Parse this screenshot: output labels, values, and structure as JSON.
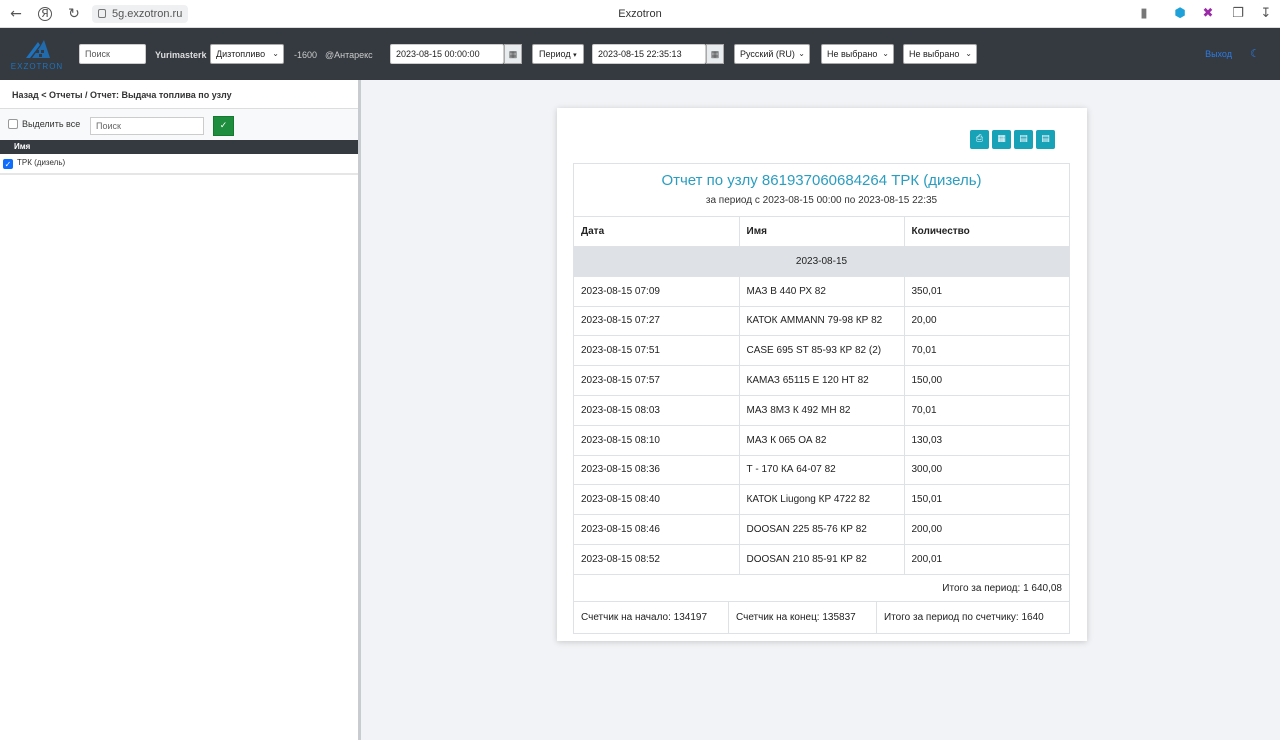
{
  "browser": {
    "url": "5g.exzotron.ru",
    "tab_title": "Exzotron"
  },
  "header": {
    "logo_text": "EXZOTRON",
    "search_placeholder": "Поиск",
    "username": "Yurimasterk",
    "fuel_select": "Дизтопливо",
    "balance": "-1600",
    "org": "@Антарекс",
    "date_from": "2023-08-15 00:00:00",
    "period_label": "Период",
    "date_to": "2023-08-15 22:35:13",
    "language": "Русский (RU)",
    "filter1": "Не выбрано",
    "filter2": "Не выбрано",
    "exit_label": "Выход"
  },
  "sidebar": {
    "breadcrumb": "Назад < Отчеты / Отчет: Выдача топлива по узлу",
    "select_all_label": "Выделить все",
    "search_placeholder": "Поиск",
    "column_header": "Имя",
    "items": [
      {
        "label": "ТРК (дизель)",
        "checked": true
      }
    ]
  },
  "report": {
    "title": "Отчет по узлу 861937060684264 ТРК (дизель)",
    "subtitle": "за период с 2023-08-15 00:00 по 2023-08-15 22:35",
    "columns": [
      "Дата",
      "Имя",
      "Количество"
    ],
    "group_label": "2023-08-15",
    "rows": [
      [
        "2023-08-15 07:09",
        "МАЗ В 440 РХ 82",
        "350,01"
      ],
      [
        "2023-08-15 07:27",
        "КАТОК AMMANN 79-98 КР 82",
        "20,00"
      ],
      [
        "2023-08-15 07:51",
        "CASE 695 ST 85-93 КР 82 (2)",
        "70,01"
      ],
      [
        "2023-08-15 07:57",
        "КАМАЗ 65115 Е 120 НТ 82",
        "150,00"
      ],
      [
        "2023-08-15 08:03",
        "МАЗ 8МЗ К 492 МН 82",
        "70,01"
      ],
      [
        "2023-08-15 08:10",
        "МАЗ К 065 ОА 82",
        "130,03"
      ],
      [
        "2023-08-15 08:36",
        "Т - 170 КА 64-07 82",
        "300,00"
      ],
      [
        "2023-08-15 08:40",
        "КАТОК Liugong КР 4722 82",
        "150,01"
      ],
      [
        "2023-08-15 08:46",
        "DOOSAN 225 85-76 КР 82",
        "200,00"
      ],
      [
        "2023-08-15 08:52",
        "DOOSAN 210 85-91 КР 82",
        "200,01"
      ]
    ],
    "total_period": "Итого за период: 1 640,08",
    "counter_start": "Счетчик на начало: 134197",
    "counter_end": "Счетчик на конец: 135837",
    "counter_total": "Итого за период по счетчику: 1640"
  },
  "colors": {
    "header_bg": "#343a40",
    "accent": "#17a2b8",
    "title": "#2a9dc0",
    "ok_button": "#1e8e3e"
  }
}
